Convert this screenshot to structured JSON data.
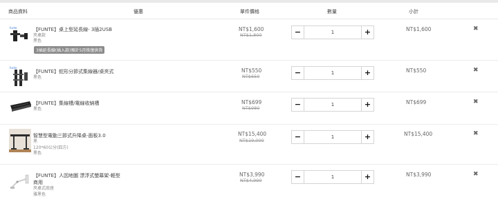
{
  "header": {
    "col_product": "商品資料",
    "col_offer": "優惠",
    "col_price": "單件價格",
    "col_qty": "數量",
    "col_subtotal": "小計"
  },
  "items": [
    {
      "name": "【FUNTE】桌上型延長線- 3插2USB",
      "options": [
        "夾桌款",
        "黑色"
      ],
      "badge": "3插延長線(插入款)預計5月恢復供貨",
      "price": "NT$1,600",
      "original_price": "NT$1,800",
      "quantity": "1",
      "subtotal": "NT$1,600"
    },
    {
      "name": "【FUNTE】蛇形分節式集線器/桌夾式",
      "options": [
        "黑色"
      ],
      "price": "NT$550",
      "original_price": "NT$650",
      "quantity": "1",
      "subtotal": "NT$550"
    },
    {
      "name": "【FUNTE】集線槽/電線收納槽",
      "options": [
        "黑色"
      ],
      "price": "NT$699",
      "original_price": "NT$980",
      "quantity": "1",
      "subtotal": "NT$699"
    },
    {
      "name": "智慧型電動三節式升降桌-面板3.0",
      "options": [
        "黑",
        "120*60公分(四方)",
        "黑色"
      ],
      "price": "NT$15,400",
      "original_price": "NT$19,000",
      "quantity": "1",
      "subtotal": "NT$15,400"
    },
    {
      "name": "【FUNTE】人因地圖 漂浮式螢幕架-輕型商用",
      "options": [
        "夾桌式底座",
        "雅黑色"
      ],
      "price": "NT$3,990",
      "original_price": "NT$4,990",
      "quantity": "1",
      "subtotal": "NT$3,990"
    }
  ],
  "controls": {
    "minus_symbol": "−",
    "plus_symbol": "+",
    "remove_symbol": "✖"
  }
}
